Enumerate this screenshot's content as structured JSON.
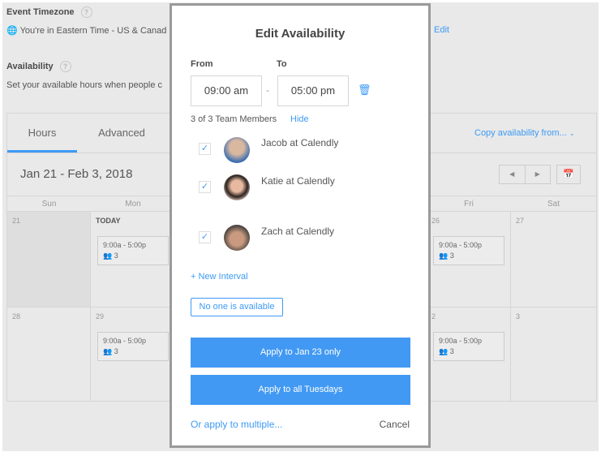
{
  "background": {
    "timezone_label": "Event Timezone",
    "timezone_text": "You're in Eastern Time - US & Canad",
    "edit_link": "Edit",
    "availability_label": "Availability",
    "availability_text": "Set your available hours when people c",
    "tabs": [
      {
        "label": "Hours",
        "active": true
      },
      {
        "label": "Advanced",
        "active": false
      }
    ],
    "copy_link": "Copy availability from...",
    "date_range": "Jan 21 - Feb 3, 2018",
    "days": [
      "Sun",
      "Mon",
      "Fri",
      "Sat"
    ],
    "week1": {
      "sun": "21",
      "mon": "TODAY",
      "fri": "26",
      "sat": "27"
    },
    "week2": {
      "sun": "28",
      "mon": "29",
      "fri": "2",
      "sat": "3"
    },
    "slot_time": "9:00a - 5:00p",
    "slot_count": "3"
  },
  "modal": {
    "title": "Edit Availability",
    "from_label": "From",
    "to_label": "To",
    "from_value": "09:00 am",
    "to_value": "05:00 pm",
    "dash": "-",
    "members_count": "3 of 3 Team Members",
    "hide_link": "Hide",
    "members": [
      {
        "name": "Jacob at Calendly",
        "checked": true
      },
      {
        "name": "Katie at Calendly",
        "checked": true
      },
      {
        "name": "Zach at Calendly",
        "checked": true
      }
    ],
    "new_interval": "+ New Interval",
    "no_one": "No one is available",
    "apply_one": "Apply to Jan 23 only",
    "apply_all": "Apply to all Tuesdays",
    "apply_multiple": "Or apply to multiple...",
    "cancel": "Cancel"
  },
  "colors": {
    "accent": "#4299f3",
    "link": "#3d9af5",
    "background": "#e9e9e9"
  }
}
